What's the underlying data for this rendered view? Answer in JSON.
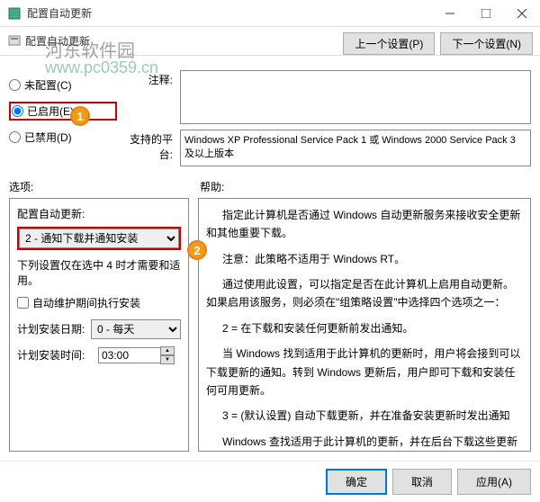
{
  "window": {
    "title": "配置自动更新"
  },
  "toolbar": {
    "title_link": "配置自动更新"
  },
  "nav": {
    "prev": "上一个设置(P)",
    "next": "下一个设置(N)"
  },
  "radios": {
    "not_configured": "未配置(C)",
    "enabled": "已启用(E)",
    "disabled": "已禁用(D)",
    "selected": "enabled"
  },
  "labels": {
    "comment": "注释:",
    "platform": "支持的平台:",
    "options": "选项:",
    "help": "帮助:"
  },
  "platform_text": "Windows XP Professional Service Pack 1 或 Windows 2000 Service Pack 3 及以上版本",
  "options_panel": {
    "group_label": "配置自动更新:",
    "update_mode": "2 - 通知下载并通知安装",
    "sub_text": "下列设置仅在选中 4 时才需要和适用。",
    "auto_maint": "自动维护期间执行安装",
    "install_day_label": "计划安装日期:",
    "install_day_value": "0 - 每天",
    "install_time_label": "计划安装时间:",
    "install_time_value": "03:00"
  },
  "help": {
    "p1": "指定此计算机是否通过 Windows 自动更新服务来接收安全更新和其他重要下载。",
    "p2": "注意：此策略不适用于 Windows RT。",
    "p3": "通过使用此设置，可以指定是否在此计算机上启用自动更新。如果启用该服务，则必须在\"组策略设置\"中选择四个选项之一：",
    "p4": "2 = 在下载和安装任何更新前发出通知。",
    "p5": "当 Windows 找到适用于此计算机的更新时，用户将会接到可以下载更新的通知。转到 Windows 更新后，用户即可下载和安装任何可用更新。",
    "p6": "3 = (默认设置) 自动下载更新，并在准备安装更新时发出通知",
    "p7": "Windows 查找适用于此计算机的更新，并在后台下载这些更新(在此过程中，用户不会收到通知或被打断工作)。完成下载后，用户将收到可以安装更新的通知。转到 Windows 更新后，用户即可安装更新。"
  },
  "watermark": {
    "text": "河东软件园",
    "url": "www.pc0359.cn"
  },
  "badges": {
    "one": "1",
    "two": "2"
  },
  "footer": {
    "ok": "确定",
    "cancel": "取消",
    "apply": "应用(A)"
  }
}
